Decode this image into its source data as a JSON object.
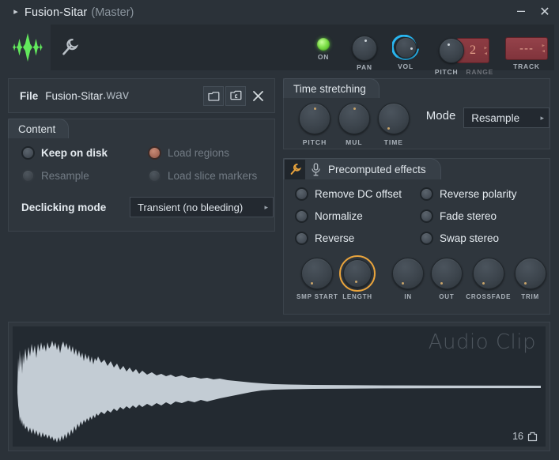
{
  "window": {
    "title": "Fusion-Sitar",
    "title_suffix": "(Master)",
    "expand_arrow": "▸",
    "minimize": "–",
    "close": "✕"
  },
  "toolbar": {
    "logo_icon": "waveform-logo-icon",
    "wrench_icon": "wrench-icon",
    "controls": [
      {
        "name": "on",
        "label": "ON",
        "type": "led",
        "state": "on"
      },
      {
        "name": "pan",
        "label": "PAN",
        "type": "knob",
        "value": "centered"
      },
      {
        "name": "vol",
        "label": "VOL",
        "type": "knob-ring",
        "value": "78%"
      },
      {
        "name": "pitch",
        "label": "PITCH",
        "type": "knob",
        "value": "centered"
      },
      {
        "name": "range",
        "label": "RANGE",
        "type": "display",
        "value": "2"
      },
      {
        "name": "track",
        "label": "TRACK",
        "type": "display",
        "value": "---"
      }
    ]
  },
  "file": {
    "label": "File",
    "name": "Fusion-Sitar",
    "extension": ".wav",
    "buttons": [
      {
        "name": "open-folder",
        "icon": "folder-icon"
      },
      {
        "name": "save-as",
        "icon": "folder-save-icon"
      },
      {
        "name": "clear-file",
        "icon": "close-x-icon"
      }
    ]
  },
  "content": {
    "tab_label": "Content",
    "options": [
      {
        "label": "Keep on disk",
        "selected": true,
        "enabled": true,
        "style": "dark"
      },
      {
        "label": "Load regions",
        "selected": false,
        "enabled": false,
        "style": "red"
      },
      {
        "label": "Resample",
        "selected": false,
        "enabled": false,
        "style": "dim"
      },
      {
        "label": "Load slice markers",
        "selected": false,
        "enabled": false,
        "style": "dim"
      }
    ],
    "declicking_label": "Declicking mode",
    "declicking_value": "Transient (no bleeding)",
    "dropdown_arrow": "▸"
  },
  "time_stretching": {
    "tab_label": "Time stretching",
    "knobs": [
      {
        "label": "PITCH",
        "position": "top"
      },
      {
        "label": "MUL",
        "position": "top"
      },
      {
        "label": "TIME",
        "position": "bottom-left"
      }
    ],
    "mode_label": "Mode",
    "mode_value": "Resample",
    "dropdown_arrow": "▸"
  },
  "precomputed_effects": {
    "tab_label": "Precomputed effects",
    "wrench_icon": "wrench-icon",
    "mic_icon": "microphone-icon",
    "checkboxes": [
      {
        "label": "Remove DC offset",
        "checked": false
      },
      {
        "label": "Reverse polarity",
        "checked": false
      },
      {
        "label": "Normalize",
        "checked": false
      },
      {
        "label": "Fade stereo",
        "checked": false
      },
      {
        "label": "Reverse",
        "checked": false
      },
      {
        "label": "Swap stereo",
        "checked": false
      }
    ],
    "knobs": [
      {
        "label": "SMP START",
        "highlighted": false
      },
      {
        "label": "LENGTH",
        "highlighted": true
      },
      {
        "label": "IN",
        "highlighted": false
      },
      {
        "label": "OUT",
        "highlighted": false
      },
      {
        "label": "CROSSFADE",
        "highlighted": false
      },
      {
        "label": "TRIM",
        "highlighted": false
      }
    ]
  },
  "waveform": {
    "watermark": "Audio Clip",
    "count": "16",
    "count_icon": "clip-icon",
    "color": "#c3ccd4",
    "background": "#232a31"
  },
  "colors": {
    "window_bg": "#2b3239",
    "panel_bg": "#2f363d",
    "toolbar_bg": "#252b31",
    "accent_green": "#7fe04a",
    "accent_blue": "#29b6f0",
    "accent_orange": "#e8a33c",
    "accent_red": "#8e3c43",
    "text": "#e4eaef",
    "text_dim": "#727b84"
  }
}
